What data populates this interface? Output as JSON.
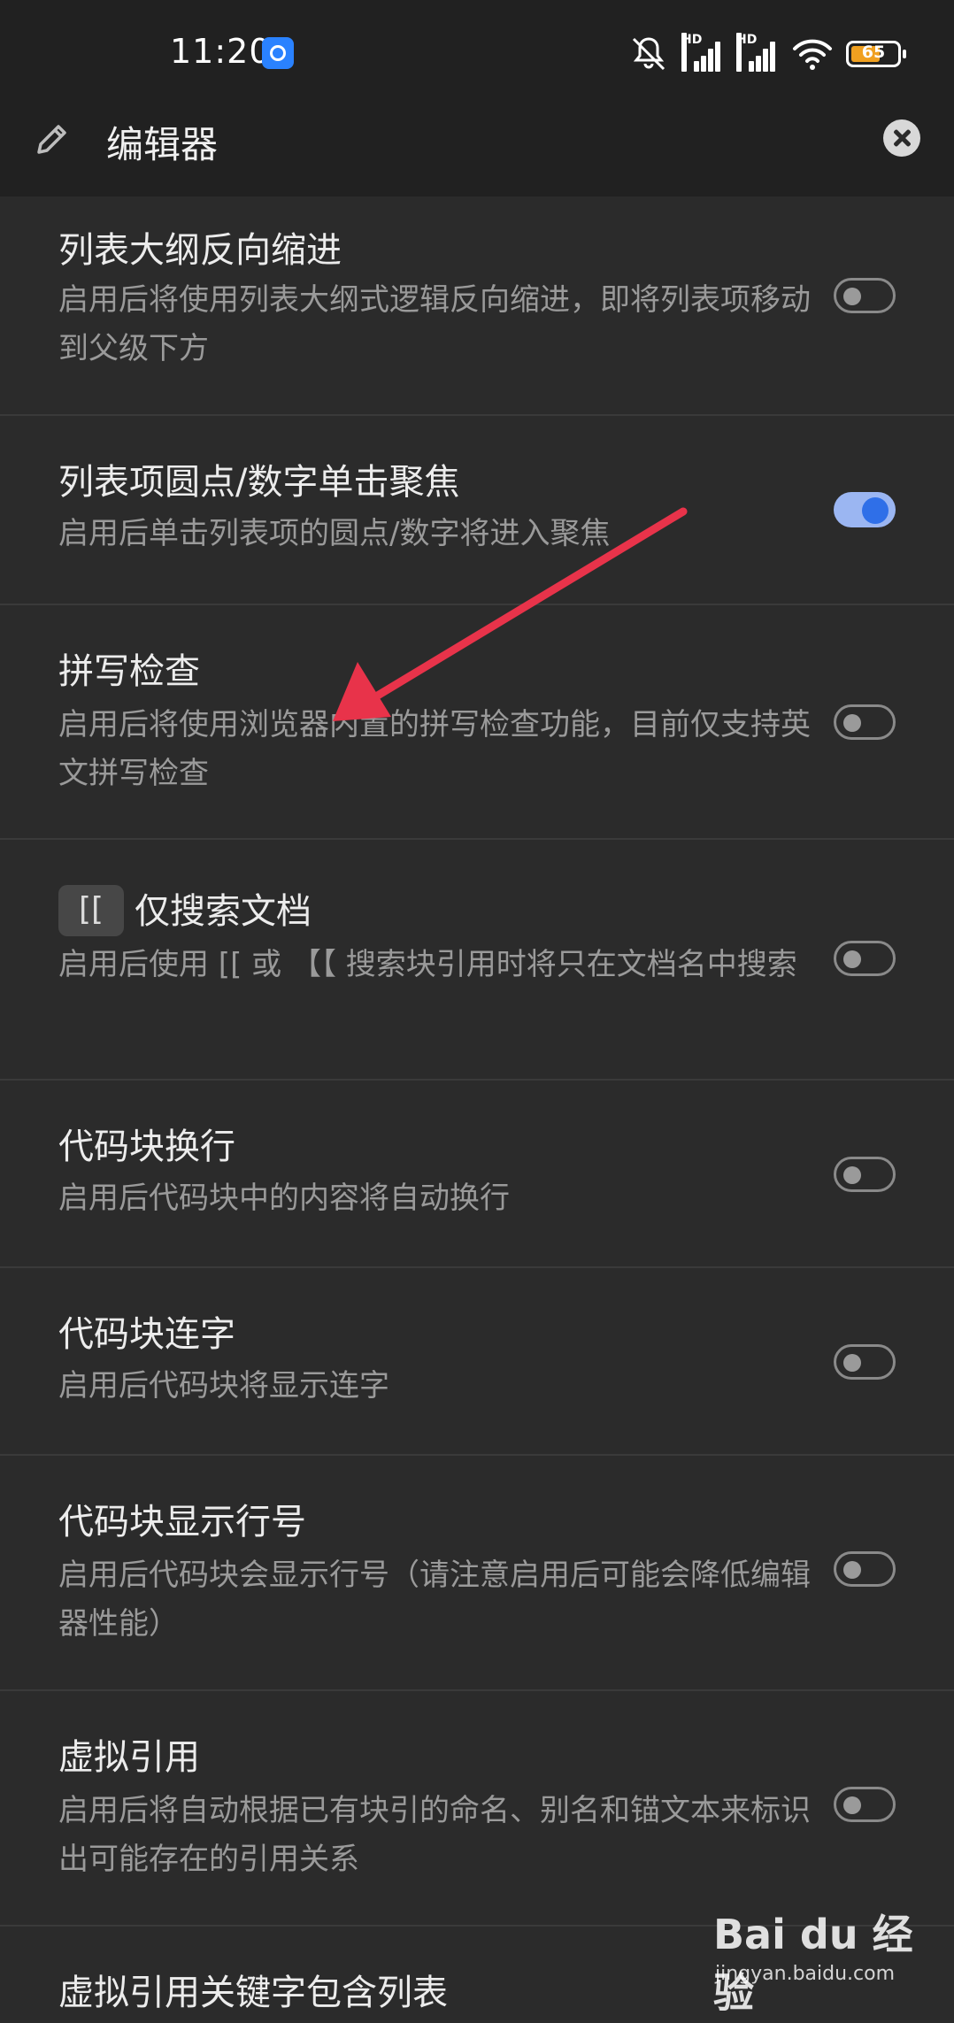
{
  "status": {
    "time": "11:20",
    "battery": "65",
    "hd1": "HD",
    "hd2": "HD"
  },
  "header": {
    "title": "编辑器"
  },
  "settings": [
    {
      "title": "列表大纲反向缩进",
      "desc": "启用后将使用列表大纲式逻辑反向缩进，即将列表项移动到父级下方",
      "enabled": false
    },
    {
      "title": "列表项圆点/数字单击聚焦",
      "desc": "启用后单击列表项的圆点/数字将进入聚焦",
      "enabled": true
    },
    {
      "title": "拼写检查",
      "desc": "启用后将使用浏览器内置的拼写检查功能，目前仅支持英文拼写检查",
      "enabled": false
    },
    {
      "title": "仅搜索文档",
      "badge": "[[",
      "desc": "启用后使用 [[ 或 【【 搜索块引用时将只在文档名中搜索",
      "enabled": false
    },
    {
      "title": "代码块换行",
      "desc": "启用后代码块中的内容将自动换行",
      "enabled": false
    },
    {
      "title": "代码块连字",
      "desc": "启用后代码块将显示连字",
      "enabled": false
    },
    {
      "title": "代码块显示行号",
      "desc": "启用后代码块会显示行号（请注意启用后可能会降低编辑器性能）",
      "enabled": false
    },
    {
      "title": "虚拟引用",
      "desc": "启用后将自动根据已有块引的命名、别名和锚文本来标识出可能存在的引用关系",
      "enabled": false
    },
    {
      "title": "虚拟引用关键字包含列表",
      "desc": "",
      "enabled": false
    }
  ],
  "watermark": {
    "main": "Bai du 经验",
    "sub": "jingyan.baidu.com"
  },
  "colors": {
    "background": "#2b2b2b",
    "bar": "#212121",
    "accent": "#2f6fe8",
    "arrow": "#e8334a"
  }
}
